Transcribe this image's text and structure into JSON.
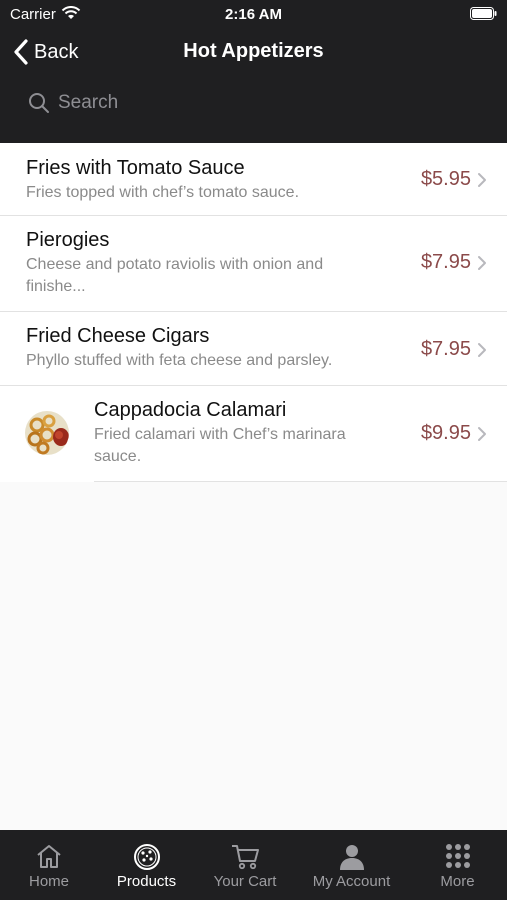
{
  "status_bar": {
    "carrier": "Carrier",
    "time": "2:16 AM"
  },
  "nav": {
    "back_label": "Back",
    "title": "Hot Appetizers"
  },
  "search": {
    "placeholder": "Search"
  },
  "items": [
    {
      "name": "Fries with Tomato Sauce",
      "description": "Fries topped with chef’s tomato sauce.",
      "price": "$5.95"
    },
    {
      "name": "Pierogies",
      "description": "Cheese and potato raviolis with onion and finishe...",
      "price": "$7.95"
    },
    {
      "name": "Fried Cheese Cigars",
      "description": "Phyllo stuffed with feta cheese and parsley.",
      "price": "$7.95"
    },
    {
      "name": "Cappadocia Calamari",
      "description": "Fried calamari with Chef’s marinara sauce.",
      "price": "$9.95",
      "has_image": true
    }
  ],
  "tabs": [
    {
      "label": "Home",
      "icon": "home-icon",
      "active": false
    },
    {
      "label": "Products",
      "icon": "pizza-icon",
      "active": true
    },
    {
      "label": "Your Cart",
      "icon": "cart-icon",
      "active": false
    },
    {
      "label": "My Account",
      "icon": "person-icon",
      "active": false
    },
    {
      "label": "More",
      "icon": "grid-icon",
      "active": false
    }
  ],
  "colors": {
    "bar_bg": "#1f1f21",
    "price": "#8b4a4a",
    "tab_active": "#ffffff",
    "tab_inactive": "#9c9ca0"
  }
}
